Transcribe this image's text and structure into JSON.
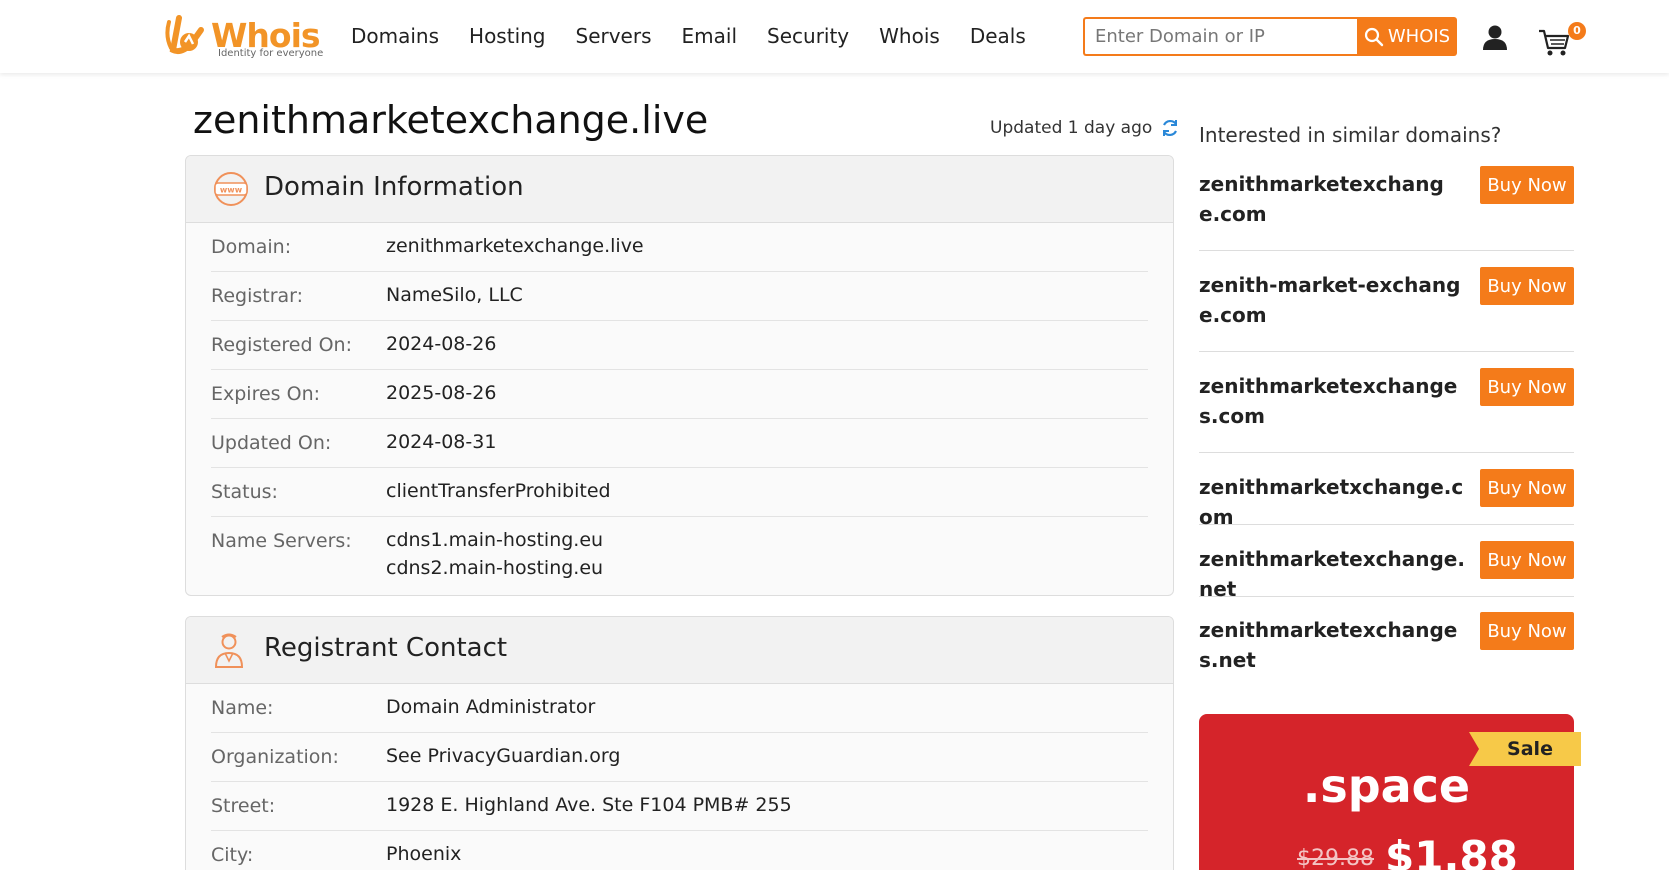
{
  "header": {
    "logo_text": "Whois",
    "logo_tagline": "Identity for everyone",
    "nav": [
      "Domains",
      "Hosting",
      "Servers",
      "Email",
      "Security",
      "Whois",
      "Deals"
    ],
    "search_placeholder": "Enter Domain or IP",
    "search_button": "WHOIS",
    "cart_count": "0"
  },
  "main": {
    "domain_title": "zenithmarketexchange.live",
    "updated": "Updated 1 day ago",
    "domain_info": {
      "title": "Domain Information",
      "rows": [
        {
          "label": "Domain:",
          "value": "zenithmarketexchange.live"
        },
        {
          "label": "Registrar:",
          "value": "NameSilo, LLC"
        },
        {
          "label": "Registered On:",
          "value": "2024-08-26"
        },
        {
          "label": "Expires On:",
          "value": "2025-08-26"
        },
        {
          "label": "Updated On:",
          "value": "2024-08-31"
        },
        {
          "label": "Status:",
          "value": "clientTransferProhibited"
        },
        {
          "label": "Name Servers:",
          "value": "cdns1.main-hosting.eu",
          "value2": "cdns2.main-hosting.eu"
        }
      ]
    },
    "registrant": {
      "title": "Registrant Contact",
      "rows": [
        {
          "label": "Name:",
          "value": "Domain Administrator"
        },
        {
          "label": "Organization:",
          "value": "See PrivacyGuardian.org"
        },
        {
          "label": "Street:",
          "value": "1928 E. Highland Ave. Ste F104 PMB# 255"
        },
        {
          "label": "City:",
          "value": "Phoenix"
        }
      ]
    }
  },
  "sidebar": {
    "title": "Interested in similar domains?",
    "buy_label": "Buy Now",
    "suggestions": [
      "zenithmarketexchange.com",
      "zenith-market-exchange.com",
      "zenithmarketexchanges.com",
      "zenithmarketxchange.com",
      "zenithmarketexchange.net",
      "zenithmarketexchanges.net"
    ],
    "promo": {
      "tag": "Sale",
      "extension": ".space",
      "old_price": "$29.88",
      "new_price": "$1.88"
    }
  },
  "colors": {
    "accent": "#f47b1a",
    "promo_red": "#d5242a",
    "sale_yellow": "#f7c948"
  }
}
